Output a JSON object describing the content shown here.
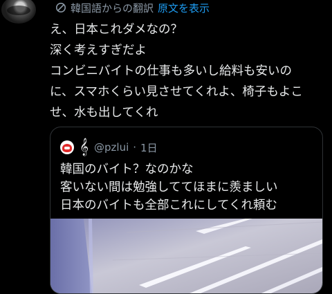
{
  "translate": {
    "label": "韓国語からの翻訳",
    "show_original": "原文を表示"
  },
  "tweet": {
    "text": "え、日本これダメなの？\n深く考えすぎだよ\nコンビニバイトの仕事も多いし給料も安いの\nに、スマホくらい見させてくれよ、椅子もよこ\nせ、水も出してくれ"
  },
  "quote": {
    "handle": "@pzlui",
    "separator": "·",
    "time": "1日",
    "text": "韓国のバイト？なのかな\n客いない間は勉強しててほまに羨ましい\n日本のバイトも全部これにしてくれ頼む"
  },
  "colors": {
    "background": "#000000",
    "text": "#e7e9ea",
    "muted": "#8b98a5",
    "link": "#1d9bf0",
    "border": "#2f3336"
  }
}
